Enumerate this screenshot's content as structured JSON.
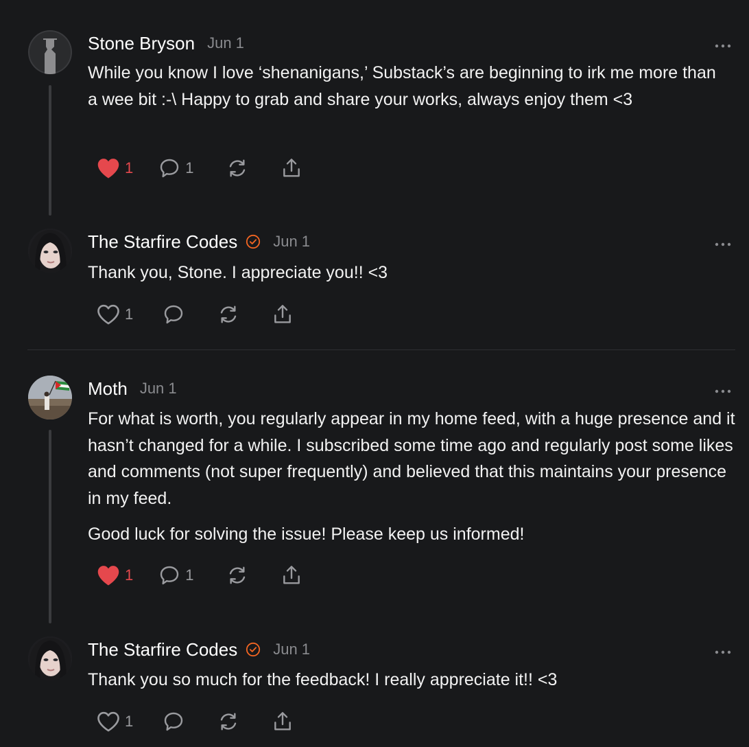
{
  "comments": [
    {
      "author": "Stone Bryson",
      "date": "Jun 1",
      "text": [
        "While you know I love ‘shenanigans,’ Substack’s are beginning to irk me more than a wee bit :-\\ Happy to grab and share your works, always enjoy them <3"
      ],
      "likes": "1",
      "replies": "1",
      "liked": true
    },
    {
      "author": "The Starfire Codes",
      "date": "Jun 1",
      "verified": true,
      "text": [
        "Thank you, Stone. I appreciate you!! <3"
      ],
      "likes": "1",
      "replies": "",
      "liked": false
    },
    {
      "author": "Moth",
      "date": "Jun 1",
      "text": [
        "For what is worth, you regularly appear in my home feed, with a huge presence and it hasn’t changed for a while. I subscribed some time ago and regularly post some likes and comments (not super frequently) and believed that this maintains your presence in my feed.",
        "Good luck for solving the issue! Please keep us informed!"
      ],
      "likes": "1",
      "replies": "1",
      "liked": true
    },
    {
      "author": "The Starfire Codes",
      "date": "Jun 1",
      "verified": true,
      "text": [
        "Thank you so much for the feedback! I really appreciate it!! <3"
      ],
      "likes": "1",
      "replies": "",
      "liked": false
    }
  ],
  "colors": {
    "background": "#18191b",
    "like_active": "#e5484d",
    "verified_badge": "#f26522",
    "muted": "#8a8b8f"
  },
  "icons": [
    "ellipsis-icon",
    "heart-icon",
    "comment-icon",
    "restack-icon",
    "share-icon",
    "verified-badge-icon"
  ]
}
